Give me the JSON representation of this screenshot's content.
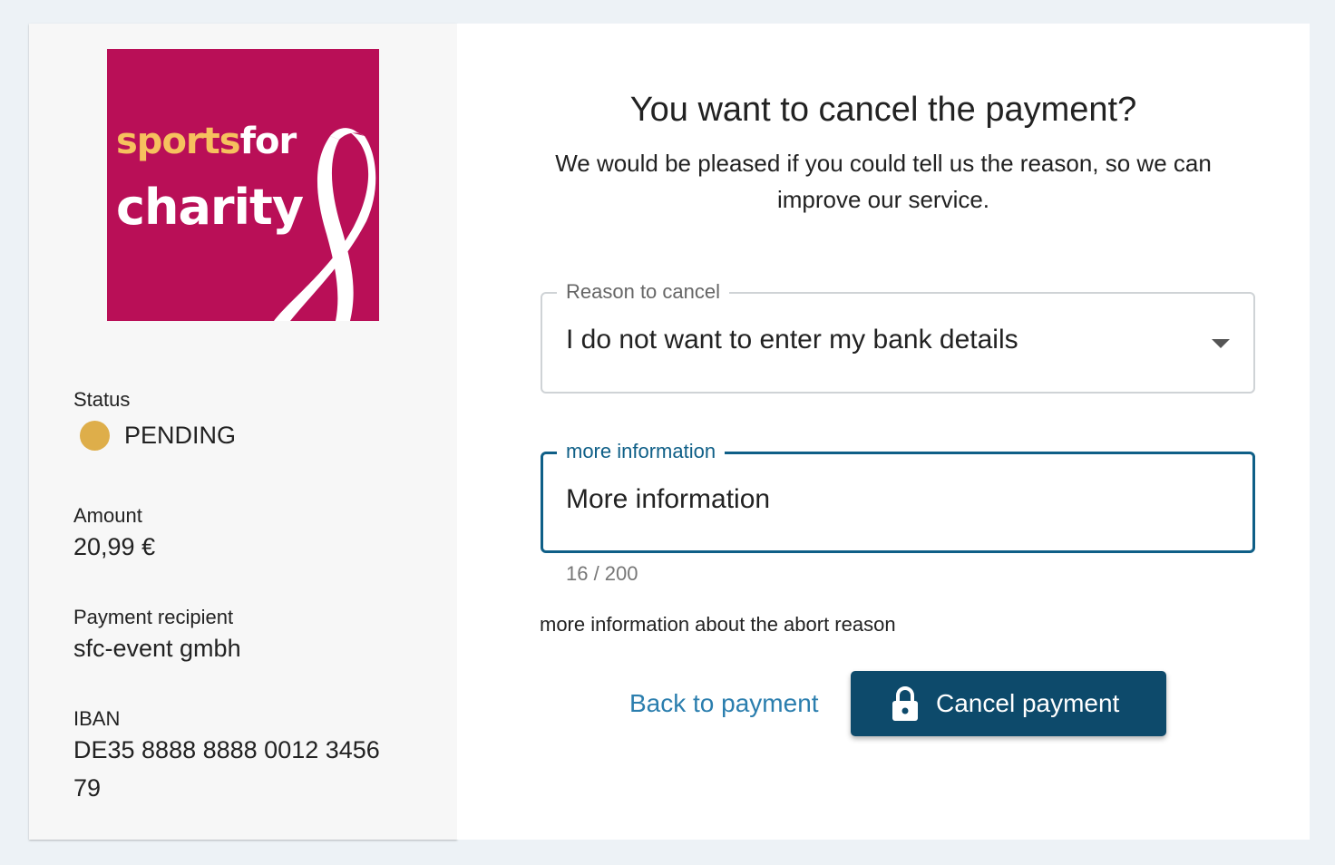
{
  "sidebar": {
    "logo": {
      "line1_part1": "sports",
      "line1_part2": "for",
      "line2": "charity",
      "colors": {
        "background": "#b90f57",
        "accent": "#f6c15e"
      }
    },
    "status": {
      "label": "Status",
      "value": "PENDING",
      "color": "#deae4a"
    },
    "amount": {
      "label": "Amount",
      "value": "20,99 €"
    },
    "recipient": {
      "label": "Payment recipient",
      "value": "sfc-event gmbh"
    },
    "iban": {
      "label": "IBAN",
      "value": "DE35 8888 8888 0012 3456 79"
    }
  },
  "main": {
    "title": "You want to cancel the payment?",
    "subtitle": "We would be pleased if you could tell us the reason, so we can improve our service.",
    "reason_field": {
      "label": "Reason to cancel",
      "value": "I do not want to enter my bank details",
      "icon": "chevron-down-icon"
    },
    "info_field": {
      "label": "more information",
      "value": "More information",
      "counter": "16 / 200",
      "accent_color": "#0f5f87"
    },
    "hint": "more information about the abort reason",
    "back_link": "Back to payment",
    "cancel_button": {
      "label": "Cancel payment",
      "icon": "lock-icon",
      "color": "#0d4a6b"
    }
  }
}
